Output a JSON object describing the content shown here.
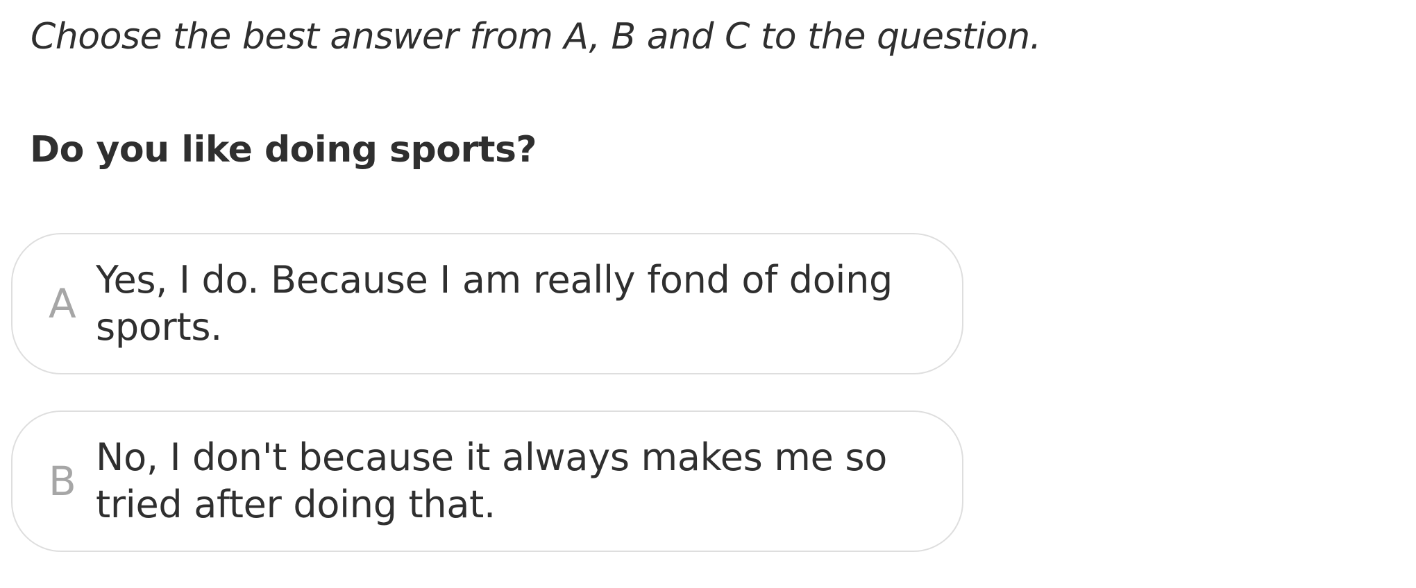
{
  "instruction": "Choose the best answer from A, B and C to the question.",
  "question": "Do you like doing sports?",
  "options": [
    {
      "letter": "A",
      "text": "Yes, I do. Because I am really fond of doing sports."
    },
    {
      "letter": "B",
      "text": "No, I don't because it always makes me so tried after doing that."
    }
  ],
  "colors": {
    "text": "#2f2f2f",
    "letter": "#a6a6a6",
    "border": "#dedede",
    "background": "#ffffff"
  }
}
